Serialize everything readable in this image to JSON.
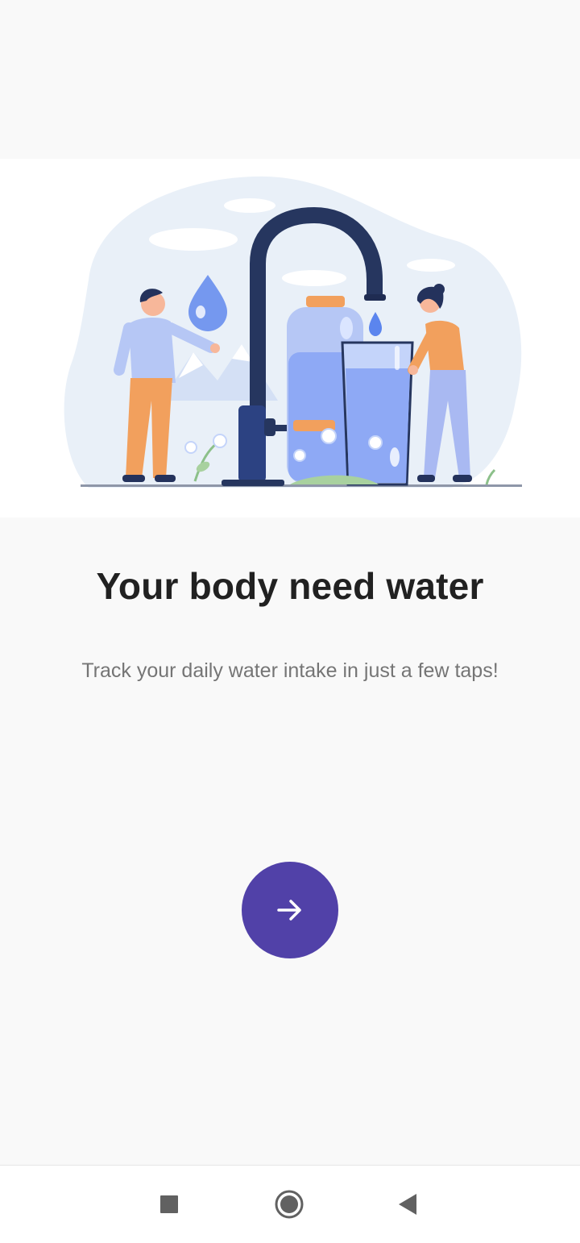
{
  "onboarding": {
    "title": "Your body need water",
    "subtitle": "Track your daily water intake in just a few taps!",
    "next_icon": "arrow-right-icon",
    "accent_color": "#5141a8"
  },
  "illustration": {
    "subject": "people-filling-water-from-tap-illustration"
  },
  "system_nav": {
    "recents_icon": "square-icon",
    "home_icon": "circle-icon",
    "back_icon": "triangle-back-icon"
  }
}
